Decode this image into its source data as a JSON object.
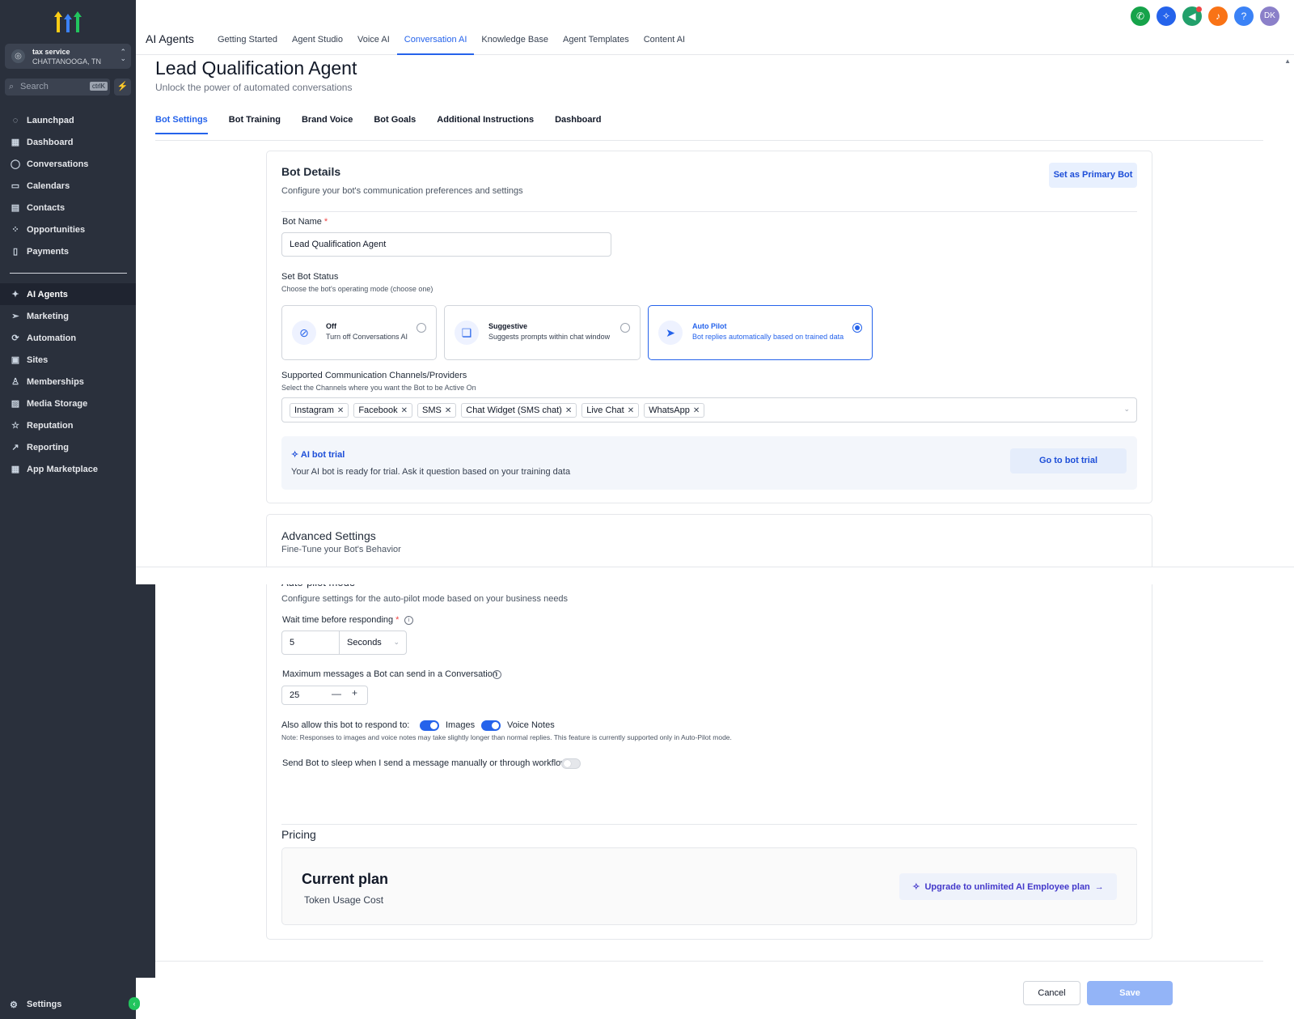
{
  "sidebar": {
    "location": {
      "name": "tax service",
      "city": "CHATTANOOGA, TN"
    },
    "search": {
      "placeholder": "Search",
      "shortcut": "ctrlK"
    },
    "items_top": [
      {
        "label": "Launchpad",
        "icon": "launchpad-icon"
      },
      {
        "label": "Dashboard",
        "icon": "dashboard-icon"
      },
      {
        "label": "Conversations",
        "icon": "chat-icon"
      },
      {
        "label": "Calendars",
        "icon": "calendar-icon"
      },
      {
        "label": "Contacts",
        "icon": "contacts-icon"
      },
      {
        "label": "Opportunities",
        "icon": "opportunities-icon"
      },
      {
        "label": "Payments",
        "icon": "payments-icon"
      }
    ],
    "items_bottom": [
      {
        "label": "AI Agents",
        "icon": "sparkle-icon",
        "active": true
      },
      {
        "label": "Marketing",
        "icon": "send-icon"
      },
      {
        "label": "Automation",
        "icon": "automation-icon"
      },
      {
        "label": "Sites",
        "icon": "sites-icon"
      },
      {
        "label": "Memberships",
        "icon": "memberships-icon"
      },
      {
        "label": "Media Storage",
        "icon": "media-icon"
      },
      {
        "label": "Reputation",
        "icon": "star-icon"
      },
      {
        "label": "Reporting",
        "icon": "reporting-icon"
      },
      {
        "label": "App Marketplace",
        "icon": "apps-icon"
      }
    ],
    "settings_label": "Settings"
  },
  "topbar": {
    "app_title": "AI Agents",
    "tabs": [
      "Getting Started",
      "Agent Studio",
      "Voice AI",
      "Conversation AI",
      "Knowledge Base",
      "Agent Templates",
      "Content AI"
    ],
    "active_tab": "Conversation AI",
    "user_initials": "DK",
    "colors": {
      "phone": "#16a34a",
      "ai": "#2563eb",
      "announce": "#22a06b",
      "bell": "#f97316",
      "help": "#3b82f6",
      "user": "#8b80c9"
    }
  },
  "page": {
    "title": "Lead Qualification Agent",
    "subtitle": "Unlock the power of automated conversations",
    "tabs": [
      "Bot Settings",
      "Bot Training",
      "Brand Voice",
      "Bot Goals",
      "Additional Instructions",
      "Dashboard"
    ],
    "active_tab": "Bot Settings"
  },
  "bot_details": {
    "title": "Bot Details",
    "subtitle": "Configure your bot's communication preferences and settings",
    "primary_btn": "Set as Primary Bot",
    "name_label": "Bot Name",
    "name_value": "Lead Qualification Agent",
    "status_label": "Set Bot Status",
    "status_hint": "Choose the bot's operating mode (choose one)",
    "status_options": [
      {
        "title": "Off",
        "desc": "Turn off Conversations AI",
        "selected": false
      },
      {
        "title": "Suggestive",
        "desc": "Suggests prompts within chat window",
        "selected": false
      },
      {
        "title": "Auto Pilot",
        "desc": "Bot replies automatically based on trained data",
        "selected": true
      }
    ],
    "channels_label": "Supported Communication Channels/Providers",
    "channels_hint": "Select the Channels where you want the Bot to be Active On",
    "channels": [
      "Instagram",
      "Facebook",
      "SMS",
      "Chat Widget (SMS chat)",
      "Live Chat",
      "WhatsApp"
    ],
    "trial_title": "AI bot trial",
    "trial_desc": "Your AI bot is ready for trial. Ask it question based on your training data",
    "trial_btn": "Go to bot trial"
  },
  "advanced": {
    "title": "Advanced Settings",
    "subtitle": "Fine-Tune your Bot's Behavior",
    "autopilot_title": "Auto-pilot mode",
    "autopilot_desc": "Configure settings for the auto-pilot mode based on your business needs",
    "wait_label": "Wait time before responding",
    "wait_value": "5",
    "wait_unit": "Seconds",
    "max_label": "Maximum messages a Bot can send in a Conversation",
    "max_value": "25",
    "respond_label": "Also allow this bot to respond to:",
    "images_label": "Images",
    "images_on": true,
    "voice_label": "Voice Notes",
    "voice_on": true,
    "note": "Note: Responses to images and voice notes may take slightly longer than normal replies. This feature is currently supported only in Auto-Pilot mode.",
    "sleep_label": "Send Bot to sleep when I send a message manually or through workflow",
    "sleep_on": false
  },
  "pricing": {
    "title": "Pricing",
    "plan_title": "Current plan",
    "plan_sub": "Token Usage Cost",
    "upgrade_btn": "Upgrade to unlimited AI Employee plan"
  },
  "footer": {
    "cancel": "Cancel",
    "save": "Save"
  }
}
